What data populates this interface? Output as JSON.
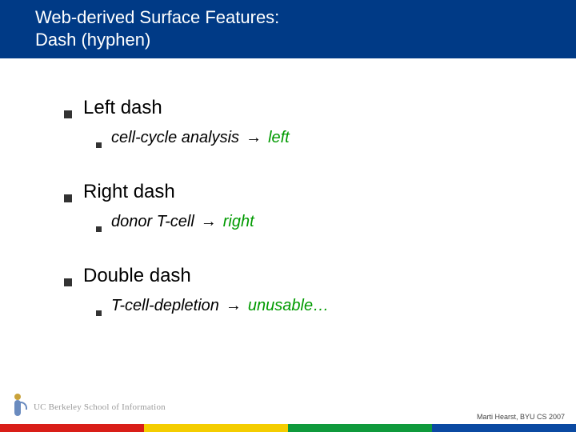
{
  "title_line1": "Web-derived Surface Features:",
  "title_line2": "Dash (hyphen)",
  "bullets": [
    {
      "label": "Left dash",
      "example": "cell-cycle analysis",
      "arrow": "→",
      "result": "left"
    },
    {
      "label": "Right dash",
      "example": "donor T-cell",
      "arrow": "→",
      "result": "right"
    },
    {
      "label": "Double dash",
      "example": "T-cell-depletion",
      "arrow": "→",
      "result": "unusable…"
    }
  ],
  "logo_text": "UC Berkeley School of Information",
  "attribution": "Marti Hearst, BYU CS 2007",
  "colors": {
    "title_band": "#003a86",
    "result_green": "#009a00",
    "stripe_red": "#d91e18",
    "stripe_yellow": "#f4cd00",
    "stripe_green": "#0f9a3c",
    "stripe_blue": "#0b4aa2"
  }
}
